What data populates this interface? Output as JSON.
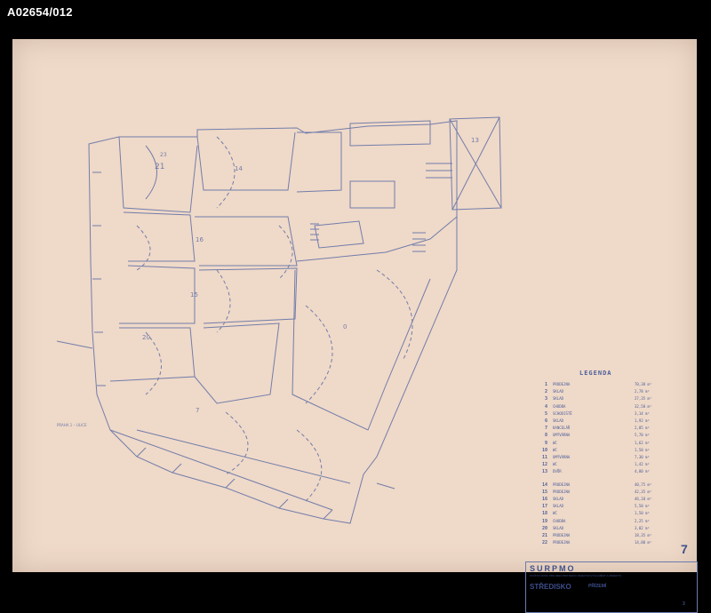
{
  "header": {
    "archive_id": "A02654/012"
  },
  "legend": {
    "title": "LEGENDA",
    "rooms": [
      {
        "num": "1",
        "name": "PRODEJNA",
        "area": "70,38 m²"
      },
      {
        "num": "2",
        "name": "SKLAD",
        "area": "2,78 m²"
      },
      {
        "num": "3",
        "name": "SKLAD",
        "area": "27,35 m²"
      },
      {
        "num": "4",
        "name": "CHODBA",
        "area": "32,50 m²"
      },
      {
        "num": "5",
        "name": "SCHODIŠTĚ",
        "area": "3,14 m²"
      },
      {
        "num": "6",
        "name": "SKLAD",
        "area": "1,92 m²"
      },
      {
        "num": "7",
        "name": "KANCELÁŘ",
        "area": "2,85 m²"
      },
      {
        "num": "8",
        "name": "UMÝVÁRNA",
        "area": "5,70 m²"
      },
      {
        "num": "9",
        "name": "WC",
        "area": "1,62 m²"
      },
      {
        "num": "10",
        "name": "WC",
        "area": "1,50 m²"
      },
      {
        "num": "11",
        "name": "UMÝVÁRNA",
        "area": "7,30 m²"
      },
      {
        "num": "12",
        "name": "WC",
        "area": "1,42 m²"
      },
      {
        "num": "13",
        "name": "DVŮR",
        "area": "4,80 m²"
      },
      {
        "num": "14",
        "name": "PRODEJNA",
        "area": "40,75 m²"
      },
      {
        "num": "15",
        "name": "PRODEJNA",
        "area": "42,35 m²"
      },
      {
        "num": "16",
        "name": "SKLAD",
        "area": "46,18 m²"
      },
      {
        "num": "17",
        "name": "SKLAD",
        "area": "5,50 m²"
      },
      {
        "num": "18",
        "name": "WC",
        "area": "1,50 m²"
      },
      {
        "num": "19",
        "name": "CHODBA",
        "area": "2,25 m²"
      },
      {
        "num": "20",
        "name": "SKLAD",
        "area": "3,02 m²"
      },
      {
        "num": "21",
        "name": "PRODEJNA",
        "area": "18,35 m²"
      },
      {
        "num": "22",
        "name": "PRODEJNA",
        "area": "14,80 m²"
      }
    ]
  },
  "plan_labels": {
    "r0": "0",
    "r7": "7",
    "r14": "14",
    "r15": "15",
    "r16": "16",
    "r18": "18",
    "r20": "20",
    "r21": "21",
    "r23": "23",
    "r13": "13",
    "street": "PRAHA 1 – ULICE"
  },
  "title_block": {
    "logo": "SURPMO",
    "logo_sub": "STÁTNÍ ÚSTAV PRO REKONSTRUKCI PAMÁTKOVÝCH MĚST A OBJEKTŮ",
    "logo2": "STŘEDISKO",
    "project": "PŘÍZEMÍ",
    "sheet_number": "7",
    "sheet_code": "3"
  }
}
